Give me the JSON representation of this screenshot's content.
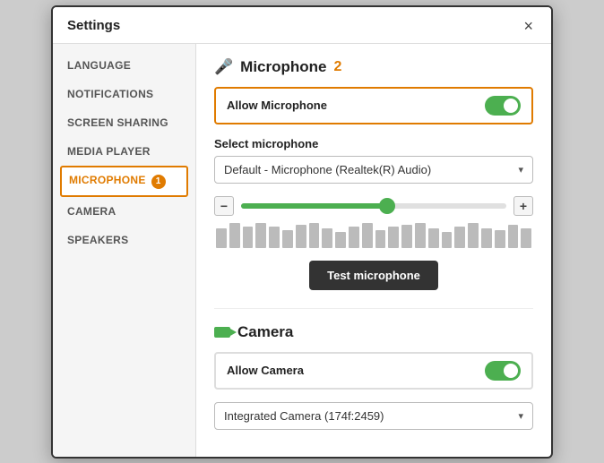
{
  "modal": {
    "title": "Settings",
    "close_label": "×"
  },
  "sidebar": {
    "items": [
      {
        "id": "language",
        "label": "LANGUAGE",
        "active": false
      },
      {
        "id": "notifications",
        "label": "NOTIFICATIONS",
        "active": false
      },
      {
        "id": "screen-sharing",
        "label": "SCREEN SHARING",
        "active": false
      },
      {
        "id": "media-player",
        "label": "MEDIA PLAYER",
        "active": false
      },
      {
        "id": "microphone",
        "label": "MICROPHONE",
        "active": true,
        "badge": "1"
      },
      {
        "id": "camera",
        "label": "CAMERA",
        "active": false
      },
      {
        "id": "speakers",
        "label": "SPEAKERS",
        "active": false
      }
    ]
  },
  "microphone_section": {
    "title": "Microphone",
    "badge": "2",
    "allow_label": "Allow Microphone",
    "allow_enabled": true,
    "select_label": "Select microphone",
    "select_value": "Default - Microphone (Realtek(R) Audio)",
    "test_button_label": "Test microphone",
    "slider_value": 55
  },
  "camera_section": {
    "title": "Camera",
    "allow_label": "Allow Camera",
    "allow_enabled": true,
    "select_value": "Integrated Camera (174f:2459)"
  },
  "audio_bars": [
    22,
    28,
    24,
    28,
    24,
    20,
    26,
    28,
    22,
    18,
    24,
    28,
    20,
    24,
    26,
    28,
    22,
    18,
    24,
    28,
    22,
    20,
    26,
    22
  ]
}
